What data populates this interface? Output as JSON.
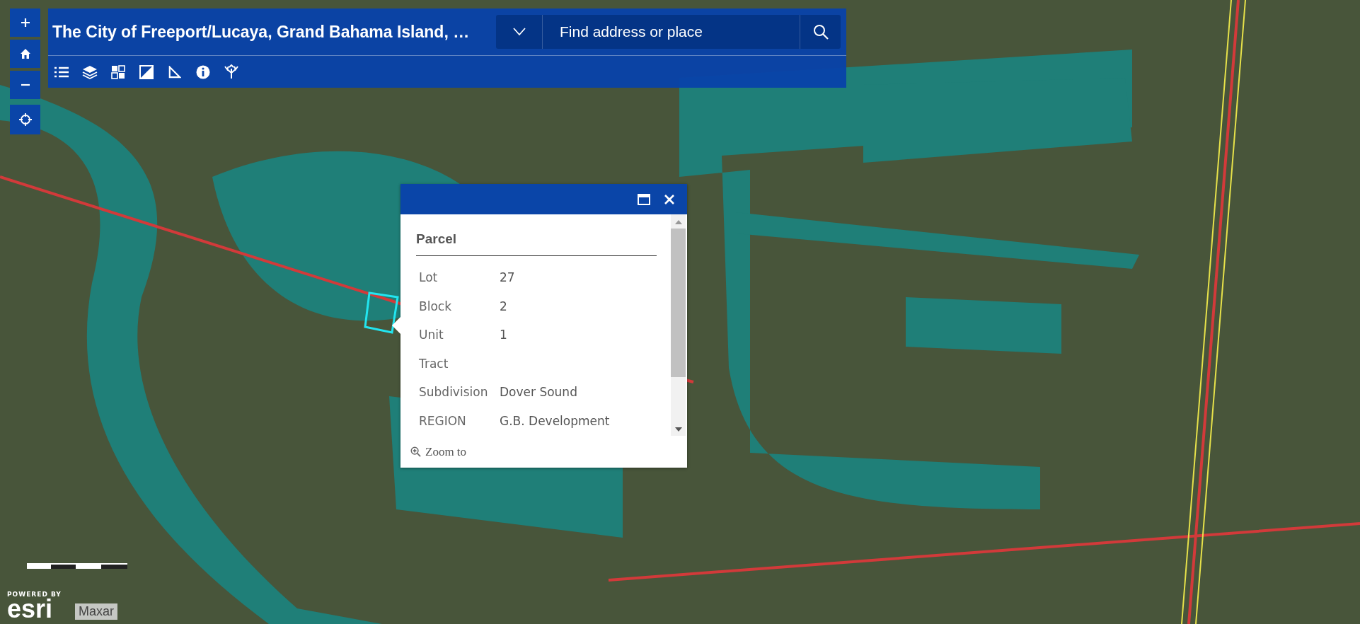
{
  "header": {
    "title": "The City of Freeport/Lucaya, Grand Bahama Island, …",
    "search": {
      "placeholder": "Find address or place"
    }
  },
  "popup": {
    "title": "Parcel",
    "fields": [
      {
        "label": "Lot",
        "value": "27"
      },
      {
        "label": "Block",
        "value": "2"
      },
      {
        "label": "Unit",
        "value": "1"
      },
      {
        "label": "Tract"
      },
      {
        "label": "Subdivision",
        "value": "Dover Sound"
      },
      {
        "label": "REGION",
        "value": "G.B. Development"
      }
    ],
    "action": "Zoom to"
  },
  "attribution": {
    "logo_caption": "POWERED BY",
    "logo": "esri",
    "credit": "Maxar"
  }
}
